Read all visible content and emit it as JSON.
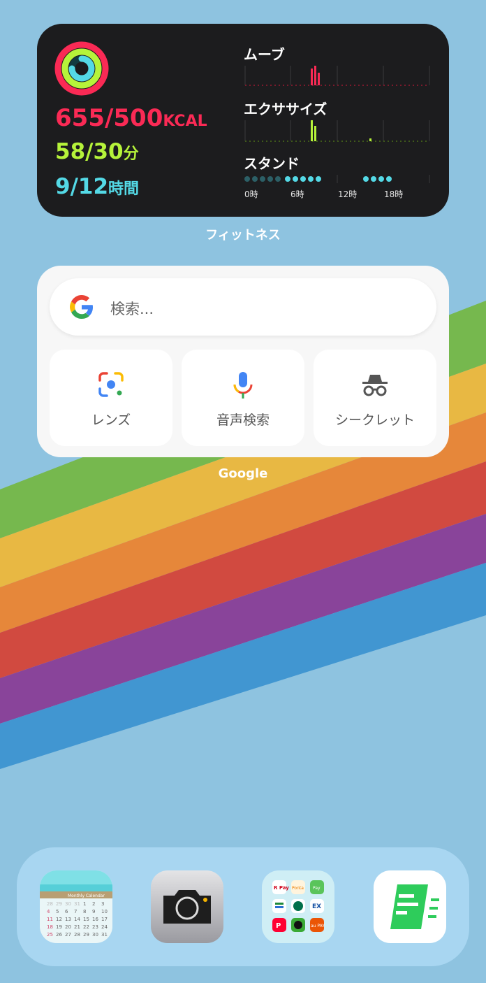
{
  "fitness": {
    "move_value": "655/500",
    "move_unit": "KCAL",
    "exercise_value": "58/30",
    "exercise_unit": "分",
    "stand_value": "9/12",
    "stand_unit": "時間",
    "move_label": "ムーブ",
    "exercise_label": "エクササイズ",
    "stand_label": "スタンド",
    "hour_labels": [
      "0時",
      "6時",
      "12時",
      "18時"
    ],
    "move_progress_pct": 131,
    "exercise_progress_pct": 193,
    "stand_progress_pct": 75,
    "colors": {
      "move": "#fa2a55",
      "exercise": "#b6f33a",
      "stand": "#54d9e6"
    }
  },
  "fitness_caption": "フィットネス",
  "google": {
    "search_placeholder": "検索...",
    "buttons": [
      {
        "label": "レンズ",
        "icon": "lens-icon"
      },
      {
        "label": "音声検索",
        "icon": "microphone-icon"
      },
      {
        "label": "シークレット",
        "icon": "incognito-icon"
      }
    ]
  },
  "google_caption": "Google",
  "dock": {
    "apps": [
      {
        "name": "monthly-calendar",
        "icon": "calendar-icon",
        "header_text": "Monthly Calendar"
      },
      {
        "name": "camera",
        "icon": "camera-icon"
      },
      {
        "name": "payment-folder",
        "icon": "folder-icon",
        "tiles": [
          "R Pay",
          "Ponta",
          "Pay",
          "EX",
          "au PAY"
        ]
      },
      {
        "name": "notes-app",
        "icon": "notes-icon"
      }
    ]
  },
  "calendar_days": [
    "28",
    "29",
    "30",
    "31",
    "1",
    "2",
    "3",
    "4",
    "5",
    "6",
    "7",
    "8",
    "9",
    "10",
    "11",
    "12",
    "13",
    "14",
    "15",
    "16",
    "17",
    "18",
    "19",
    "20",
    "21",
    "22",
    "23",
    "24",
    "25",
    "26",
    "27",
    "28",
    "29",
    "30",
    "31"
  ]
}
